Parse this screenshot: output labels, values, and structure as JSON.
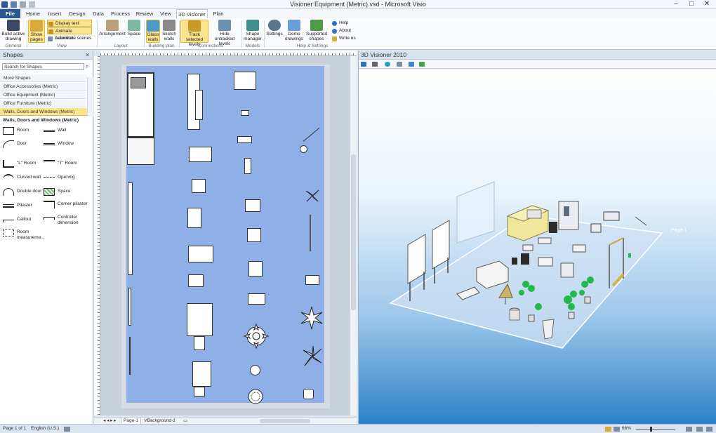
{
  "window": {
    "title": "Visioner Equipment (Metric).vsd - Microsoft Visio",
    "minimize": "–",
    "maximize": "□",
    "close": "✕"
  },
  "tabs": [
    "File",
    "Home",
    "Insert",
    "Design",
    "Data",
    "Process",
    "Review",
    "View",
    "3D Visioner",
    "Plan"
  ],
  "active_tab": "3D Visioner",
  "ribbon": {
    "build_active_drawing": "Build active drawing",
    "show_pages": "Show pages",
    "display_text_labels": "Display text labels",
    "animate_selection": "Animate selection",
    "autorotate_scenes": "Autorotate scenes",
    "arrangement": "Arrangement",
    "space": "Space",
    "glass_walls": "Glass walls",
    "sketch_walls": "Sketch walls",
    "track_selected_levels": "Track selected levels",
    "hide_untracked_levels": "Hide untracked levels",
    "shape_manager": "Shape manager",
    "settings": "Settings",
    "demo_drawings": "Demo drawings",
    "supported_shapes": "Supported shapes",
    "help": "Help",
    "about": "About",
    "write_us": "Write us",
    "groups": {
      "general": "General",
      "view": "View",
      "layout": "Layout",
      "building_plan": "Building plan",
      "connections": "Connections",
      "models": "Models",
      "help_settings": "Help & Settings"
    }
  },
  "shapes_panel": {
    "title": "Shapes",
    "close": "✕",
    "search_placeholder": "Search for Shapes",
    "stencils": [
      "More Shapes",
      "Office Accessories (Metric)",
      "Office Equipment (Metric)",
      "Office Furniture (Metric)",
      "Walls, Doors and Windows (Metric)"
    ],
    "selected_stencil": "Walls, Doors and Windows (Metric)",
    "stencil_title": "Walls, Doors and Windows (Metric)",
    "masters": [
      {
        "name": "Room"
      },
      {
        "name": "Wall"
      },
      {
        "name": "Door"
      },
      {
        "name": "Window"
      },
      {
        "name": "\"L\" Room"
      },
      {
        "name": "\"T\" Room"
      },
      {
        "name": "Curved wall"
      },
      {
        "name": "Opening"
      },
      {
        "name": "Double door"
      },
      {
        "name": "Space"
      },
      {
        "name": "Pilaster"
      },
      {
        "name": "Corner pilaster"
      },
      {
        "name": "Callout"
      },
      {
        "name": "Controller dimension"
      },
      {
        "name": "Room measureme..."
      }
    ]
  },
  "page_tabs": {
    "page1": "Page-1",
    "background": "VBackground-1"
  },
  "viewer": {
    "title": "3D Visioner 2010",
    "page_label": "Page-1"
  },
  "status": {
    "page": "Page 1 of 1",
    "language": "English (U.S.)",
    "zoom": "66%"
  },
  "colors": {
    "accent": "#2b5797",
    "highlight": "#fbe48d",
    "page_fill": "#8fb0e6"
  }
}
